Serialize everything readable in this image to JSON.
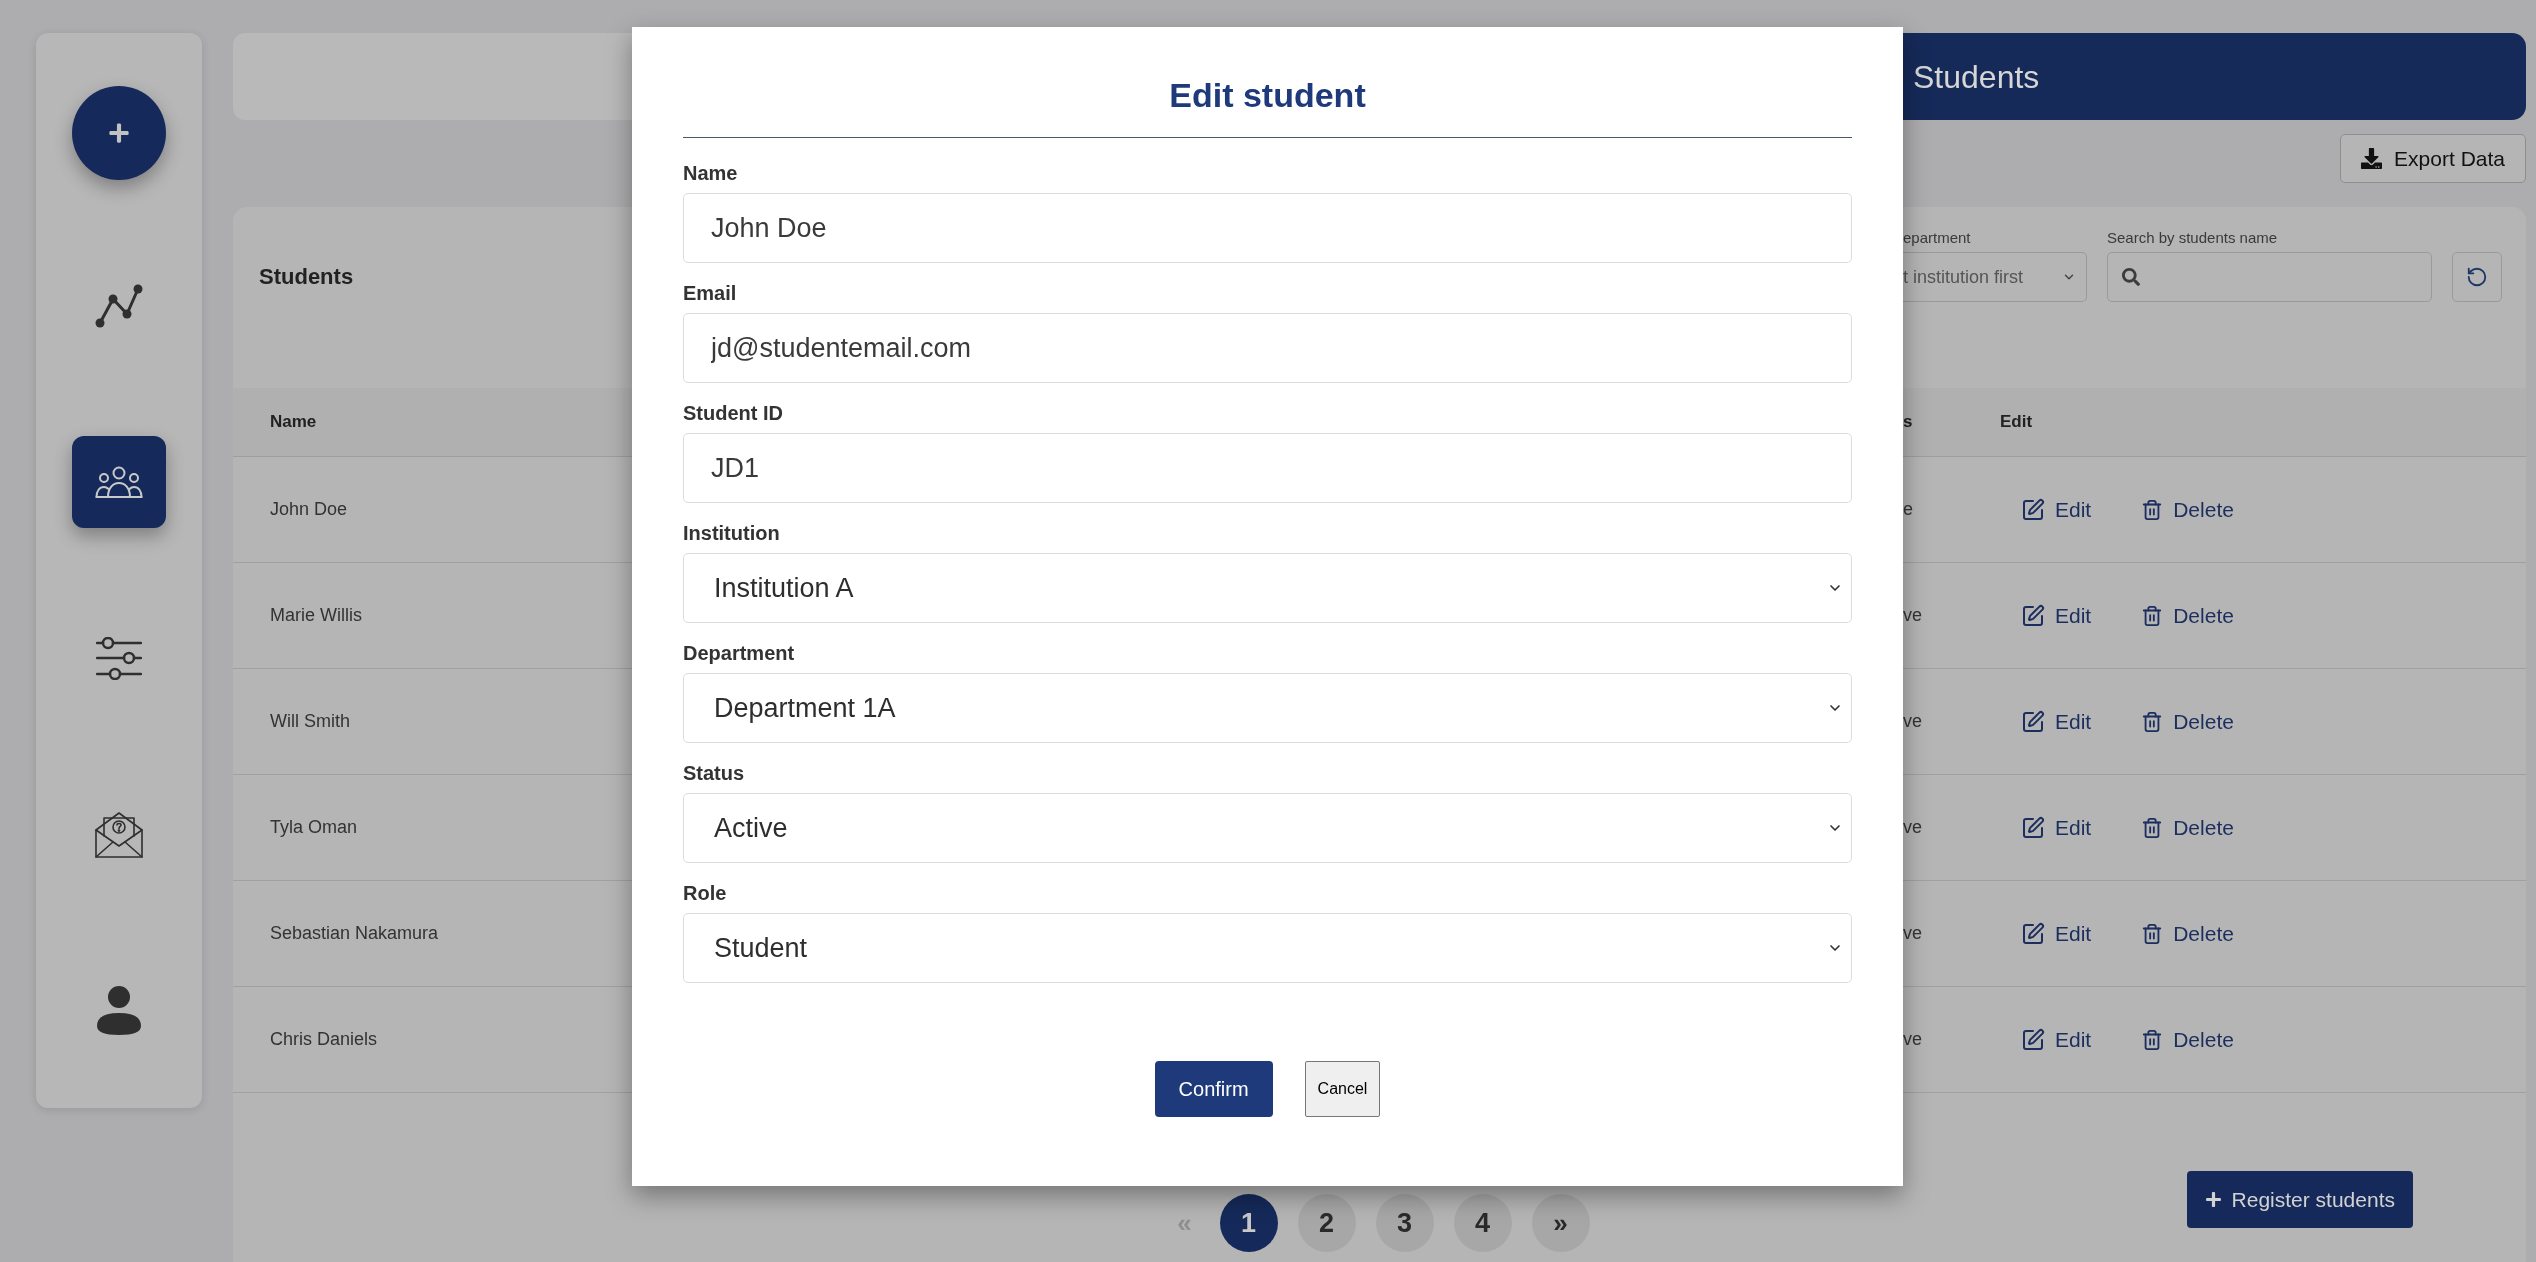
{
  "sidebar": {
    "nav_items": [
      {
        "selected": false
      },
      {
        "selected": true
      },
      {
        "selected": false
      },
      {
        "selected": false
      },
      {
        "selected": false
      }
    ]
  },
  "header": {
    "title": "Students"
  },
  "export_button": {
    "label": "Export Data"
  },
  "students_panel": {
    "title": "Students",
    "department_filter": {
      "label": "epartment",
      "placeholder": "t institution first"
    },
    "search": {
      "label": "Search by students name"
    }
  },
  "table": {
    "columns": [
      "Name",
      "s",
      "Edit"
    ],
    "rows": [
      {
        "name": "John Doe",
        "column_2": "e",
        "edit": "Edit",
        "delete": "Delete"
      },
      {
        "name": "Marie Willis",
        "column_2": "ve",
        "edit": "Edit",
        "delete": "Delete"
      },
      {
        "name": "Will Smith",
        "column_2": "ve",
        "edit": "Edit",
        "delete": "Delete"
      },
      {
        "name": "Tyla Oman",
        "column_2": "ve",
        "edit": "Edit",
        "delete": "Delete"
      },
      {
        "name": "Sebastian Nakamura",
        "column_2": "ve",
        "edit": "Edit",
        "delete": "Delete"
      },
      {
        "name": "Chris Daniels",
        "column_2": "ve",
        "edit": "Edit",
        "delete": "Delete"
      }
    ]
  },
  "pagination": {
    "previous": {
      "label": "«",
      "disabled": true
    },
    "pages": [
      {
        "label": "1",
        "selected": true
      },
      {
        "label": "2",
        "selected": false
      },
      {
        "label": "3",
        "selected": false
      },
      {
        "label": "4",
        "selected": false
      }
    ],
    "next": {
      "label": "»",
      "disabled": false
    }
  },
  "register_button": {
    "label": "Register students"
  },
  "modal": {
    "title": "Edit student",
    "fields": [
      {
        "label": "Name",
        "kind": "text",
        "value": "John Doe"
      },
      {
        "label": "Email",
        "kind": "text",
        "value": "jd@studentemail.com"
      },
      {
        "label": "Student ID",
        "kind": "text",
        "value": "JD1"
      },
      {
        "label": "Institution",
        "kind": "select",
        "value": "Institution A"
      },
      {
        "label": "Department",
        "kind": "select",
        "value": "Department 1A"
      },
      {
        "label": "Status",
        "kind": "select",
        "value": "Active"
      },
      {
        "label": "Role",
        "kind": "select",
        "value": "Student"
      }
    ],
    "buttons": [
      {
        "label": "Confirm",
        "kind": "primary"
      },
      {
        "label": "Cancel",
        "kind": "secondary"
      }
    ]
  }
}
